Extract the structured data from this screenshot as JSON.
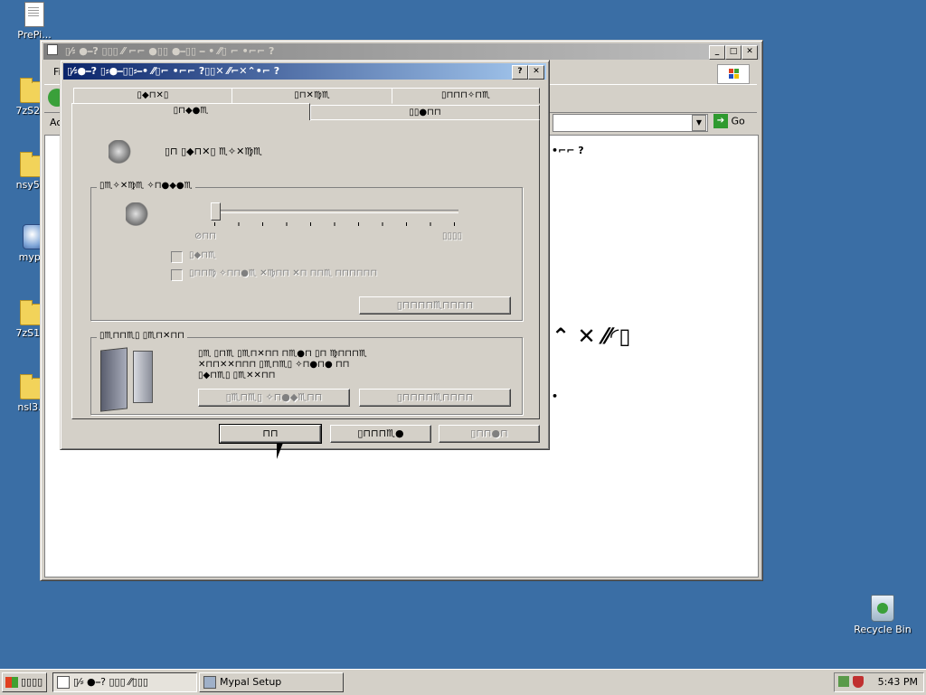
{
  "desktop": {
    "icons": [
      {
        "label": "PrePi..."
      },
      {
        "label": "7zS2..."
      },
      {
        "label": "nsy5..."
      },
      {
        "label": "myp..."
      },
      {
        "label": "7zS1..."
      },
      {
        "label": "nsl3..."
      }
    ],
    "recycle_bin": "Recycle Bin"
  },
  "explorer": {
    "title": "▯⁄⸗ ●⎯? ▯▯▯ ⁄⁄ ⌐⌐ ●▯▯ ●⎯▯▯ ⎯ • ⁄⁄▯ ⌐ •⌐⌐ ?",
    "menu_first": "Fi",
    "address_label": "Ac",
    "go_label": "Go",
    "content_text_1": "•⌐⌐ ?",
    "content_text_2": "⌃ ✕ ⁄⁄◜▯",
    "content_bullet": "•"
  },
  "dialog": {
    "title": "▯⁄⸗●⎯? ▯⸗●⎯▯▯⸗⎯• ⁄⁄▯⌐ •⌐⌐ ?▯▯✕ ⁄⁄⌐✕⌃•⌐ ?",
    "tabs_row1": [
      "▯◆⊓✕▯",
      "▯⊓✕♍♏",
      "▯⊓⊓⊓✧⊓♏"
    ],
    "tabs_row2": [
      "▯⊓◆●♏",
      "▯▯●⊓⊓"
    ],
    "device_label": "▯⊓ ▯◆⊓✕▯ ♏✧✕♍♏",
    "device_volume_group": "▯♏✧✕♍♏ ✧⊓●◆●♏",
    "slider_low": "⊘⊓⊓",
    "slider_high": "▯▯▯▯",
    "mute_label": "▯◆⊓♏",
    "place_icon_label": "▯⊓⊓♍ ✧⊓⊓●♏ ✕♍⊓⊓ ✕⊓ ⊓⊓♏ ⊓⊓⊓⊓⊓⊓",
    "advanced_button_1": "▯⊓⊓⊓⊓♏⊓⊓⊓⊓",
    "speaker_group": "▯♏⊓⊓♏▯ ▯♏⊓✕⊓⊓",
    "speaker_text_1": "▯♏ ▯⊓♏ ▯♏⊓✕⊓⊓ ⊓♏●⊓ ▯⊓ ♍⊓⊓⊓♏",
    "speaker_text_2": "✕⊓⊓✕✕⊓⊓⊓ ▯♏⊓♏▯ ✧⊓●⊓● ⊓⊓",
    "speaker_text_3": "▯◆⊓♏▯ ▯♏✕✕⊓⊓",
    "speaker_volume_button": "▯♏⊓♏▯ ✧⊓●◆♏⊓⊓",
    "advanced_button_2": "▯⊓⊓⊓⊓♏⊓⊓⊓⊓",
    "ok_button": "⊓⊓",
    "cancel_button": "▯⊓⊓⊓♏●",
    "apply_button": "▯⊓⊓●⊓"
  },
  "taskbar": {
    "start_label": "▯▯▯▯",
    "task1_label": "▯⁄⸗ ●⎯? ▯▯▯ ⁄⁄▯▯▯",
    "task2_label": "Mypal Setup",
    "clock": "5:43 PM"
  },
  "colors": {
    "desktop": "#3a6ea5",
    "title_active": "#0a246a",
    "face": "#d4d0c8"
  }
}
